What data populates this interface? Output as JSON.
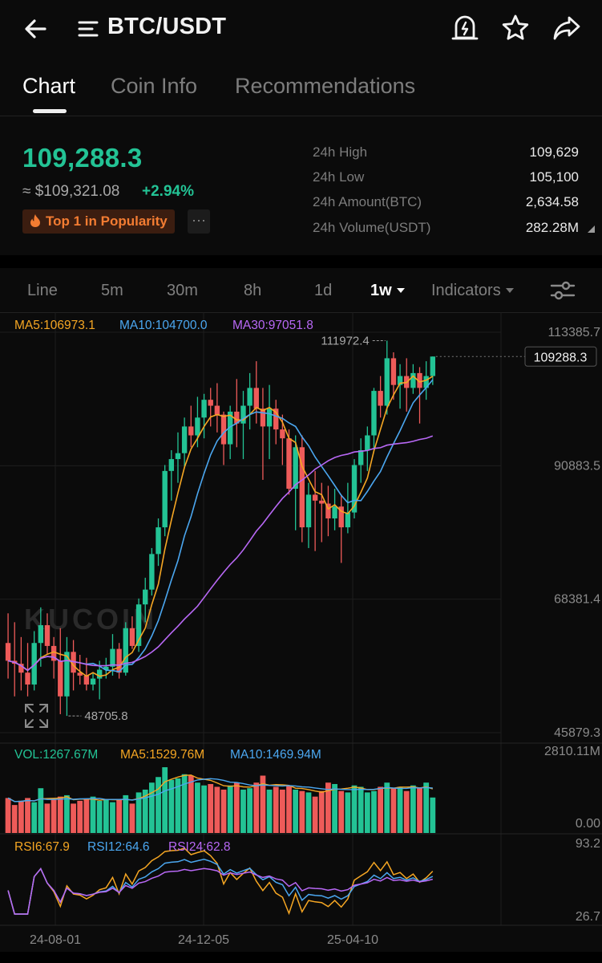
{
  "header": {
    "pair": "BTC/USDT",
    "icons": [
      "back-arrow-icon",
      "menu-icon",
      "price-alert-icon",
      "star-icon",
      "share-icon"
    ]
  },
  "tabs": [
    {
      "label": "Chart",
      "active": true
    },
    {
      "label": "Coin Info",
      "active": false
    },
    {
      "label": "Recommendations",
      "active": false
    }
  ],
  "ticker": {
    "last_price": "109,288.3",
    "usd_price": "≈ $109,321.08",
    "change": "+2.94%",
    "badge": "Top 1 in Popularity",
    "more": "···",
    "stats": [
      {
        "label": "24h High",
        "value": "109,629"
      },
      {
        "label": "24h Low",
        "value": "105,100"
      },
      {
        "label": "24h Amount(BTC)",
        "value": "2,634.58"
      },
      {
        "label": "24h Volume(USDT)",
        "value": "282.28M"
      }
    ]
  },
  "intervals": [
    {
      "label": "Line",
      "active": false
    },
    {
      "label": "5m",
      "active": false
    },
    {
      "label": "30m",
      "active": false
    },
    {
      "label": "8h",
      "active": false
    },
    {
      "label": "1d",
      "active": false
    },
    {
      "label": "1w",
      "active": true
    },
    {
      "label": "Indicators",
      "active": false
    }
  ],
  "colors": {
    "up": "#23c395",
    "down": "#ee5b59",
    "ma5": "#f5a623",
    "ma10": "#4ba7f0",
    "ma30": "#b868f5",
    "background": "#0b0b0b"
  },
  "chart_data": {
    "type": "candlestick",
    "interval": "1w",
    "price_legend": [
      {
        "text": "MA5:106973.1",
        "color_key": "ma5"
      },
      {
        "text": "MA10:104700.0",
        "color_key": "ma10"
      },
      {
        "text": "MA30:97051.8",
        "color_key": "ma30"
      }
    ],
    "price_axis_labels": [
      "113385.7",
      "90883.5",
      "68381.4",
      "45879.3"
    ],
    "price_axis": {
      "top": 113385.7,
      "bottom": 45879.3
    },
    "current_price_tag": "109288.3",
    "max_label": "111972.4",
    "min_label": "48705.8",
    "watermark": "KUCOIN",
    "candles": [
      [
        61000,
        66000,
        55000,
        58000
      ],
      [
        58000,
        64500,
        52000,
        57500
      ],
      [
        57500,
        62000,
        53000,
        56000
      ],
      [
        56000,
        61000,
        52000,
        54000
      ],
      [
        54000,
        63000,
        53000,
        61000
      ],
      [
        61000,
        67000,
        57000,
        64000
      ],
      [
        64000,
        66000,
        59000,
        60500
      ],
      [
        60500,
        62000,
        55000,
        58000
      ],
      [
        58000,
        63500,
        49000,
        52000
      ],
      [
        52000,
        62000,
        48706,
        59500
      ],
      [
        59500,
        61500,
        53000,
        56000
      ],
      [
        56000,
        59000,
        54000,
        55500
      ],
      [
        55500,
        58500,
        53000,
        54000
      ],
      [
        54000,
        56000,
        53000,
        55000
      ],
      [
        55000,
        58000,
        51500,
        56500
      ],
      [
        56500,
        58500,
        55000,
        57000
      ],
      [
        57000,
        62500,
        55500,
        60000
      ],
      [
        60000,
        61000,
        55000,
        56000
      ],
      [
        56000,
        64500,
        55500,
        63500
      ],
      [
        63500,
        65500,
        60000,
        60500
      ],
      [
        60500,
        68500,
        59500,
        67500
      ],
      [
        67500,
        72000,
        64500,
        70000
      ],
      [
        70000,
        77000,
        69000,
        76000
      ],
      [
        76000,
        82000,
        74000,
        80500
      ],
      [
        80500,
        91000,
        79000,
        90000
      ],
      [
        90000,
        93500,
        85000,
        92000
      ],
      [
        92000,
        96500,
        88000,
        93000
      ],
      [
        93000,
        99000,
        90500,
        97500
      ],
      [
        97500,
        101000,
        94000,
        96000
      ],
      [
        96000,
        102500,
        94000,
        99000
      ],
      [
        99000,
        103000,
        95500,
        102000
      ],
      [
        102000,
        104000,
        97500,
        101000
      ],
      [
        101000,
        104800,
        96500,
        99500
      ],
      [
        99500,
        100000,
        91000,
        94500
      ],
      [
        94500,
        101000,
        92000,
        100000
      ],
      [
        100000,
        105500,
        94000,
        98000
      ],
      [
        98000,
        103500,
        92000,
        101000
      ],
      [
        101000,
        106500,
        97000,
        104000
      ],
      [
        104000,
        108500,
        98000,
        100500
      ],
      [
        100500,
        104000,
        88500,
        97500
      ],
      [
        97500,
        104500,
        92000,
        100500
      ],
      [
        100500,
        102000,
        94500,
        97000
      ],
      [
        97000,
        99500,
        91000,
        95500
      ],
      [
        95500,
        97000,
        86000,
        87000
      ],
      [
        87000,
        96000,
        80000,
        94000
      ],
      [
        94000,
        96000,
        78000,
        80500
      ],
      [
        80500,
        88000,
        77000,
        86000
      ],
      [
        86000,
        90000,
        76500,
        85000
      ],
      [
        85000,
        88000,
        78000,
        84500
      ],
      [
        84500,
        87500,
        79000,
        82000
      ],
      [
        82000,
        87000,
        80000,
        84000
      ],
      [
        84000,
        86000,
        74500,
        80500
      ],
      [
        80500,
        88000,
        79500,
        83000
      ],
      [
        83000,
        92000,
        82000,
        91000
      ],
      [
        91000,
        95500,
        88000,
        93500
      ],
      [
        93500,
        97500,
        90000,
        96000
      ],
      [
        96000,
        104000,
        93500,
        103500
      ],
      [
        103500,
        106000,
        99000,
        101000
      ],
      [
        101000,
        111972,
        99500,
        109000
      ],
      [
        109000,
        110000,
        102000,
        104500
      ],
      [
        104500,
        108000,
        100500,
        106000
      ],
      [
        106000,
        109000,
        100000,
        104000
      ],
      [
        104000,
        108000,
        103000,
        106500
      ],
      [
        106500,
        107500,
        98000,
        104000
      ],
      [
        104000,
        108500,
        102000,
        106000
      ],
      [
        106000,
        109300,
        104500,
        109288
      ]
    ],
    "volume_legend": [
      {
        "text": "VOL:1267.67M",
        "color_key": "up"
      },
      {
        "text": "MA5:1529.76M",
        "color_key": "ma5"
      },
      {
        "text": "MA10:1469.94M",
        "color_key": "ma10"
      }
    ],
    "volume_axis_labels": [
      "2810.11M",
      "0.00"
    ],
    "volume_axis": {
      "top": 2810.11,
      "bottom": 0
    },
    "volumes": [
      1250,
      1000,
      1150,
      1250,
      1100,
      1600,
      1050,
      1200,
      1300,
      1350,
      1050,
      1150,
      1200,
      1300,
      1150,
      1200,
      1100,
      1200,
      1350,
      1050,
      1450,
      1550,
      1800,
      2000,
      2350,
      1900,
      1950,
      2100,
      2050,
      1800,
      1700,
      1750,
      1650,
      1550,
      1700,
      1800,
      1550,
      1600,
      1800,
      2050,
      1550,
      1650,
      1550,
      1700,
      1550,
      1500,
      1450,
      1300,
      1500,
      1800,
      1750,
      1500,
      1450,
      1700,
      1650,
      1450,
      1500,
      1650,
      1800,
      1600,
      1650,
      1500,
      1700,
      1600,
      1800,
      1267.67
    ],
    "rsi_legend": [
      {
        "text": "RSI6:67.9",
        "color_key": "ma5"
      },
      {
        "text": "RSI12:64.6",
        "color_key": "ma10"
      },
      {
        "text": "RSI24:62.8",
        "color_key": "ma30"
      }
    ],
    "rsi_axis_labels": [
      "93.2",
      "26.7"
    ],
    "rsi_axis": {
      "top": 93.2,
      "bottom": 26.7
    },
    "date_labels": [
      "24-08-01",
      "24-12-05",
      "25-04-10"
    ],
    "date_label_indices": [
      5,
      26,
      47
    ]
  }
}
